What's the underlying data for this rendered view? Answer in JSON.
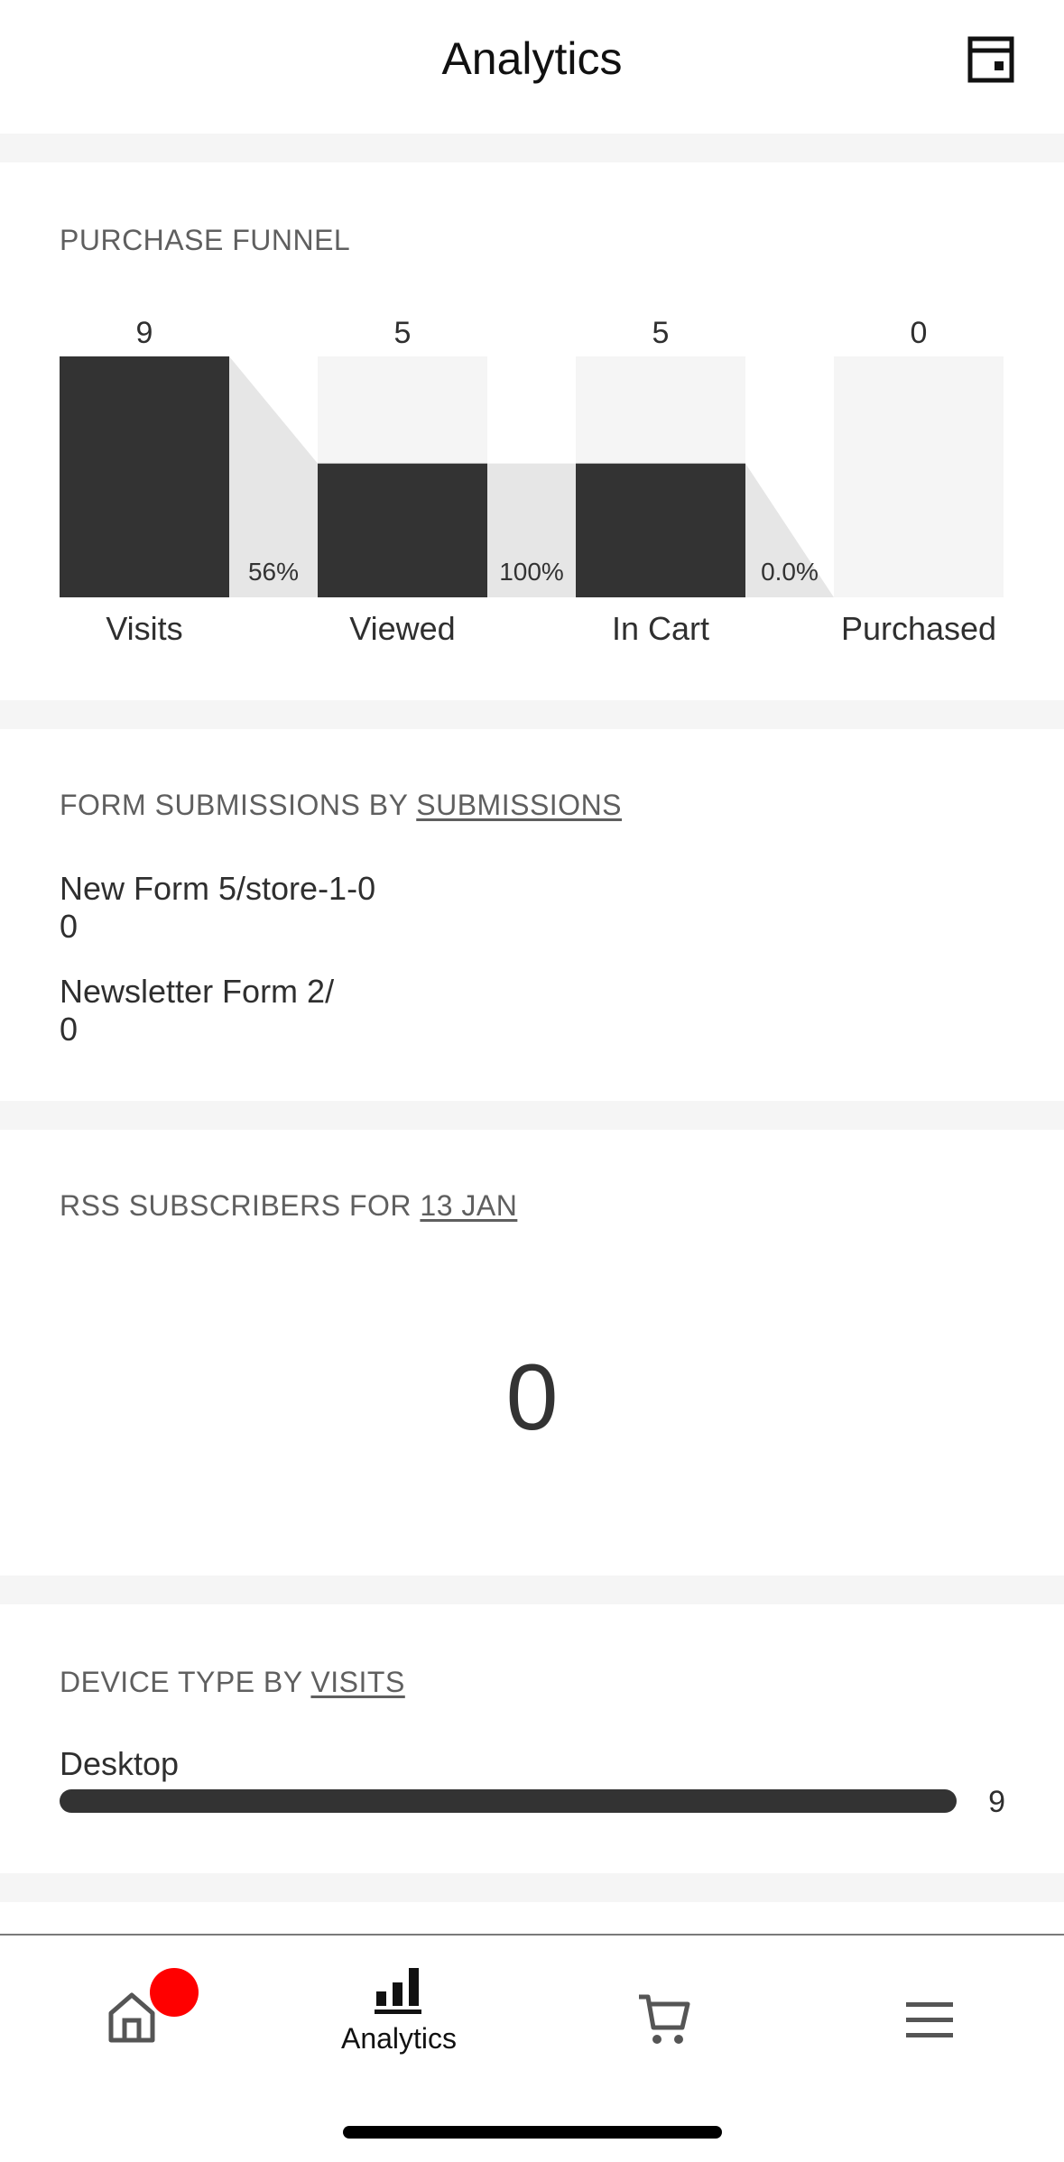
{
  "header": {
    "title": "Analytics",
    "icon": "calendar-icon"
  },
  "funnel": {
    "title": "PURCHASE FUNNEL",
    "stages": [
      {
        "label": "Visits",
        "count": "9"
      },
      {
        "label": "Viewed",
        "count": "5"
      },
      {
        "label": "In Cart",
        "count": "5"
      },
      {
        "label": "Purchased",
        "count": "0"
      }
    ],
    "conversions": [
      "56%",
      "100%",
      "0.0%"
    ]
  },
  "chart_data": {
    "type": "bar",
    "categories": [
      "Visits",
      "Viewed",
      "In Cart",
      "Purchased"
    ],
    "values": [
      9,
      5,
      5,
      0
    ],
    "title": "PURCHASE FUNNEL",
    "conversion_labels": [
      "56%",
      "100%",
      "0.0%"
    ],
    "ylim": [
      0,
      9
    ]
  },
  "forms": {
    "title_prefix": "FORM SUBMISSIONS BY ",
    "title_link": "SUBMISSIONS",
    "items": [
      {
        "name": "New Form 5/store-1-0",
        "value": "0"
      },
      {
        "name": "Newsletter Form 2/",
        "value": "0"
      }
    ]
  },
  "rss": {
    "title_prefix": "RSS SUBSCRIBERS FOR ",
    "title_link": "13 JAN",
    "value": "0"
  },
  "device": {
    "title_prefix": "DEVICE TYPE BY ",
    "title_link": "VISITS",
    "items": [
      {
        "name": "Desktop",
        "count": "9",
        "fraction": 1.0
      }
    ]
  },
  "nav": {
    "items": [
      {
        "name": "home",
        "label": "",
        "icon": "home-icon",
        "badge": true
      },
      {
        "name": "analytics",
        "label": "Analytics",
        "icon": "analytics-icon",
        "active": true
      },
      {
        "name": "commerce",
        "label": "",
        "icon": "cart-icon"
      },
      {
        "name": "menu",
        "label": "",
        "icon": "menu-icon"
      }
    ]
  },
  "colors": {
    "bar": "#333333",
    "bar_background": "#f5f5f5",
    "connector": "#e6e6e6",
    "badge": "#ff0000"
  }
}
